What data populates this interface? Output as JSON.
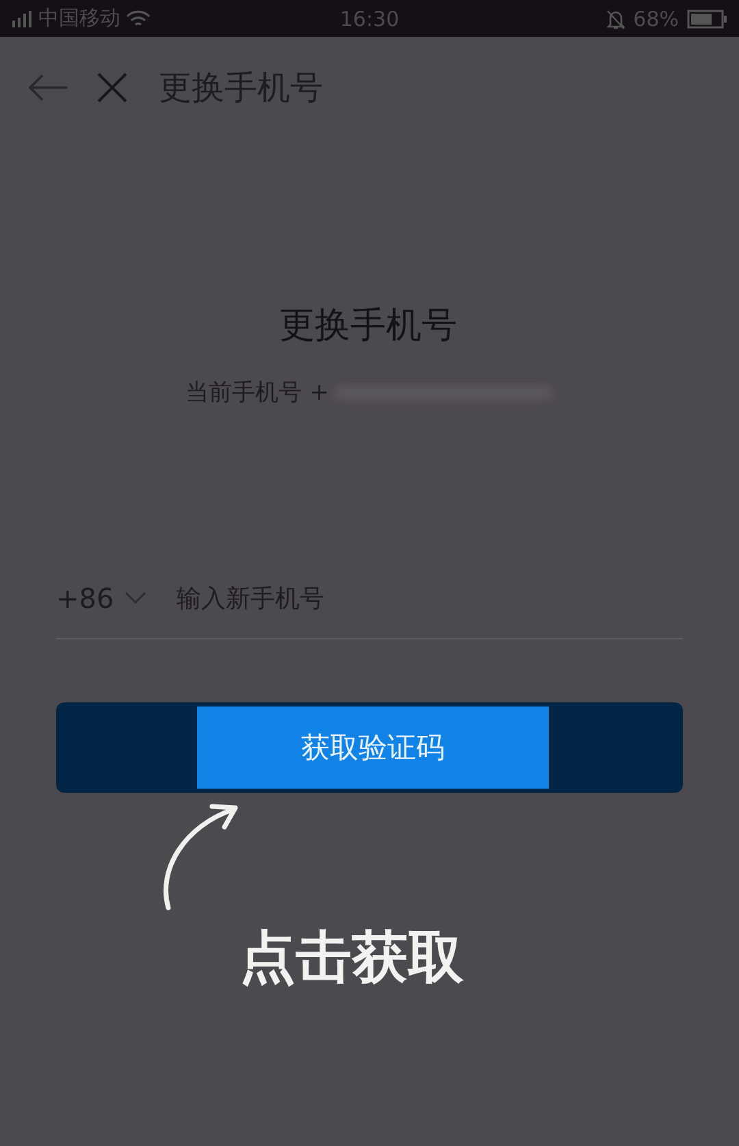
{
  "status_bar": {
    "carrier": "中国移动",
    "time": "16:30",
    "battery": "68%"
  },
  "header": {
    "title": "更换手机号"
  },
  "content": {
    "title": "更换手机号",
    "current_label": "当前手机号 +"
  },
  "phone_input": {
    "country_code": "+86",
    "placeholder": "输入新手机号"
  },
  "button": {
    "label": "获取验证码"
  },
  "hint": {
    "text": "点击获取"
  }
}
